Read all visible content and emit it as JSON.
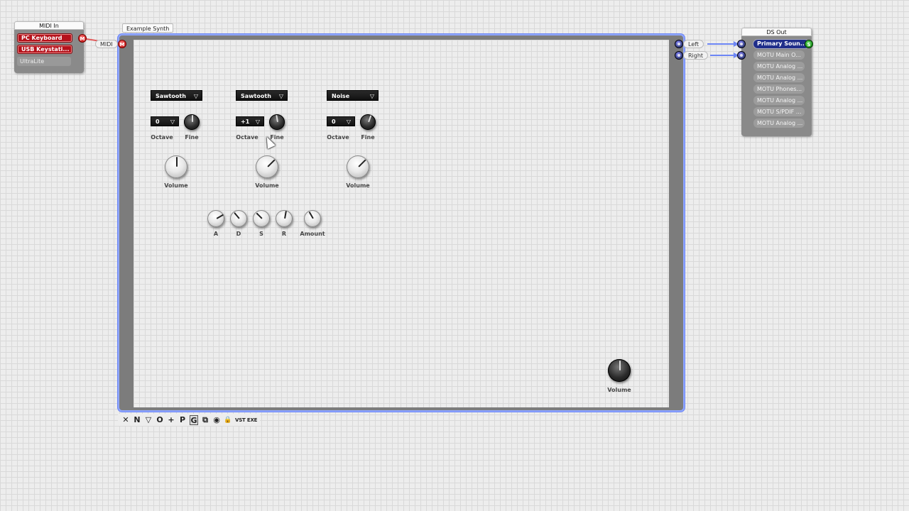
{
  "midi_in": {
    "title": "MIDI In",
    "devices": [
      "PC Keyboard",
      "USB Keystati..."
    ],
    "inactive": [
      "UltraLite"
    ],
    "port": "M"
  },
  "synth": {
    "title": "Example Synth",
    "midi_port_label": "MIDI",
    "midi_port": "M",
    "osc": [
      {
        "waveform": "Sawtooth",
        "octave": "0",
        "octave_label": "Octave",
        "fine_label": "Fine",
        "volume_label": "Volume"
      },
      {
        "waveform": "Sawtooth",
        "octave": "+1",
        "octave_label": "Octave",
        "fine_label": "Fine",
        "volume_label": "Volume"
      },
      {
        "waveform": "Noise",
        "octave": "0",
        "octave_label": "Octave",
        "fine_label": "Fine",
        "volume_label": "Volume"
      }
    ],
    "envelope": [
      "A",
      "D",
      "S",
      "R",
      "Amount"
    ],
    "master_volume_label": "Volume",
    "outputs": [
      "Left",
      "Right"
    ]
  },
  "ds_out": {
    "title": "DS Out",
    "selected": "Primary Soun...",
    "selected_port": "S",
    "devices": [
      "MOTU Main O...",
      "MOTU Analog ...",
      "MOTU Analog ...",
      "MOTU Phones...",
      "MOTU Analog ...",
      "MOTU S/PDIF ...",
      "MOTU Analog ..."
    ]
  },
  "toolbar": {
    "buttons": [
      "✕",
      "N",
      "▽",
      "O",
      "+",
      "P",
      "G",
      "⧉",
      "◉",
      "🔒",
      "VST EXE"
    ]
  },
  "colors": {
    "link_blue": "#6d86f5",
    "link_red": "#e05a5a",
    "midi_red": "#b5121b",
    "selected_blue": "#1f2d8a"
  }
}
